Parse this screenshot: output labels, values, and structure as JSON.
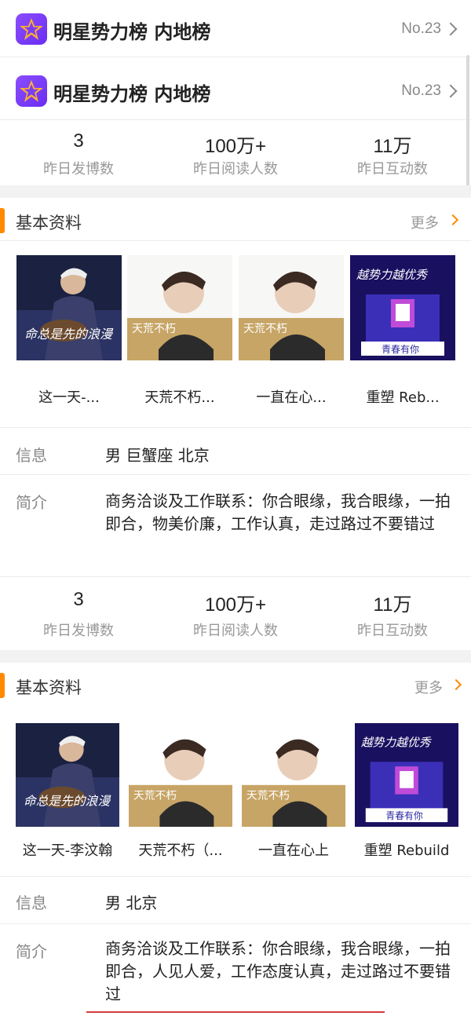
{
  "rank_rows": [
    {
      "title": "明星势力榜 内地榜",
      "rank": "No.23"
    },
    {
      "title": "明星势力榜 内地榜",
      "rank": "No.23"
    }
  ],
  "stats_1": [
    {
      "value": "3",
      "label": "昨日发博数"
    },
    {
      "value": "100万+",
      "label": "昨日阅读人数"
    },
    {
      "value": "11万",
      "label": "昨日互动数"
    }
  ],
  "section_1": {
    "title": "基本资料",
    "more": "更多",
    "albums": [
      {
        "caption": "这一天-..."
      },
      {
        "caption": "天荒不朽..."
      },
      {
        "caption": "一直在心..."
      },
      {
        "caption": "重塑 Reb..."
      }
    ],
    "info_label": "信息",
    "info_value": "男 巨蟹座 北京",
    "intro_label": "简介",
    "intro_value": "商务洽谈及工作联系：你合眼缘，我合眼缘，一拍即合，物美价廉，工作认真，走过路过不要错过"
  },
  "stats_2": [
    {
      "value": "3",
      "label": "昨日发博数"
    },
    {
      "value": "100万+",
      "label": "昨日阅读人数"
    },
    {
      "value": "11万",
      "label": "昨日互动数"
    }
  ],
  "section_2": {
    "title": "基本资料",
    "more": "更多",
    "albums": [
      {
        "caption": "这一天-李汶翰"
      },
      {
        "caption": "天荒不朽（..."
      },
      {
        "caption": "一直在心上"
      },
      {
        "caption": "重塑 Rebuild"
      }
    ],
    "info_label": "信息",
    "info_value": "男 北京",
    "intro_label": "简介",
    "intro_value": "商务洽谈及工作联系：你合眼缘，我合眼缘，一拍即合，人见人爱，工作态度认真，走过路过不要错过"
  },
  "album_art": {
    "cover_1_text": "命总是先的浪漫",
    "cover_2_text": "天荒不朽",
    "cover_4_text_1": "越势力越优秀",
    "cover_4_text_2": "青春有你"
  },
  "colors": {
    "accent": "#ff8a00",
    "rank_icon": "#7a3cf5",
    "muted": "#999999"
  },
  "icons": {
    "rank": "star-rank-icon",
    "chevron": "chevron-right-icon"
  }
}
